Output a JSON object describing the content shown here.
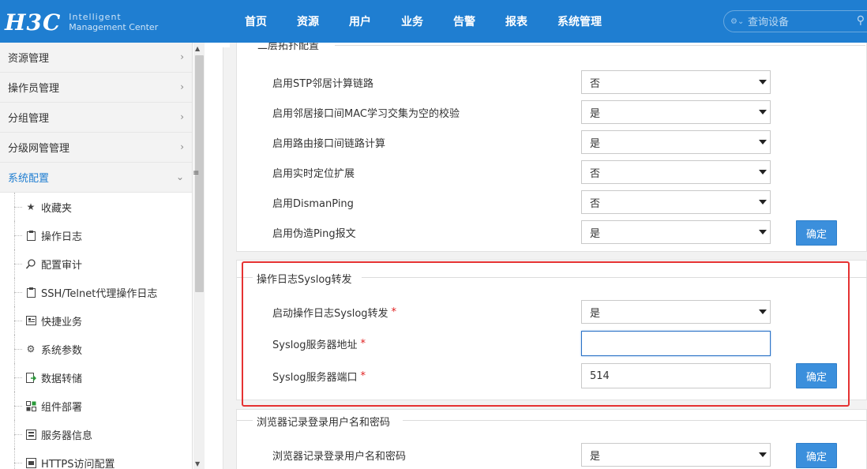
{
  "header": {
    "logo_main": "H3C",
    "logo_line1": "Intelligent",
    "logo_line2": "Management Center",
    "nav": [
      "首页",
      "资源",
      "用户",
      "业务",
      "告警",
      "报表",
      "系统管理"
    ],
    "search_placeholder": "查询设备",
    "search_scope_icon": "device-scope-icon"
  },
  "sidebar": {
    "groups": [
      {
        "label": "资源管理"
      },
      {
        "label": "操作员管理"
      },
      {
        "label": "分组管理"
      },
      {
        "label": "分级网管管理"
      },
      {
        "label": "系统配置"
      }
    ],
    "sub_items": [
      {
        "label": "收藏夹",
        "icon": "star-icon"
      },
      {
        "label": "操作日志",
        "icon": "clipboard-icon"
      },
      {
        "label": "配置审计",
        "icon": "audit-search-icon"
      },
      {
        "label": "SSH/Telnet代理操作日志",
        "icon": "clipboard-icon"
      },
      {
        "label": "快捷业务",
        "icon": "shortcut-icon"
      },
      {
        "label": "系统参数",
        "icon": "gear-icon"
      },
      {
        "label": "数据转储",
        "icon": "data-dump-icon"
      },
      {
        "label": "组件部署",
        "icon": "component-icon"
      },
      {
        "label": "服务器信息",
        "icon": "server-info-icon"
      },
      {
        "label": "HTTPS访问配置",
        "icon": "https-icon"
      }
    ]
  },
  "topology_section": {
    "title": "二层拓扑配置",
    "rows": [
      {
        "label": "启用STP邻居计算链路",
        "value": "否"
      },
      {
        "label": "启用邻居接口间MAC学习交集为空的校验",
        "value": "是"
      },
      {
        "label": "启用路由接口间链路计算",
        "value": "是"
      },
      {
        "label": "启用实时定位扩展",
        "value": "否"
      },
      {
        "label": "启用DismanPing",
        "value": "否"
      },
      {
        "label": "启用伪造Ping报文",
        "value": "是"
      }
    ],
    "confirm_label": "确定"
  },
  "syslog_section": {
    "title": "操作日志Syslog转发",
    "enable_label": "启动操作日志Syslog转发",
    "enable_value": "是",
    "server_addr_label": "Syslog服务器地址",
    "server_addr_value": "",
    "server_port_label": "Syslog服务器端口",
    "server_port_value": "514",
    "required_mark": "*",
    "confirm_label": "确定"
  },
  "browser_section": {
    "title": "浏览器记录登录用户名和密码",
    "row_label": "浏览器记录登录用户名和密码",
    "row_value": "是",
    "confirm_label": "确定"
  },
  "colors": {
    "header_bg": "#1f7ed1",
    "button_bg": "#3b8fdc",
    "highlight_border": "#e53232",
    "active_menu": "#1f7ed1",
    "required": "#e02020"
  }
}
